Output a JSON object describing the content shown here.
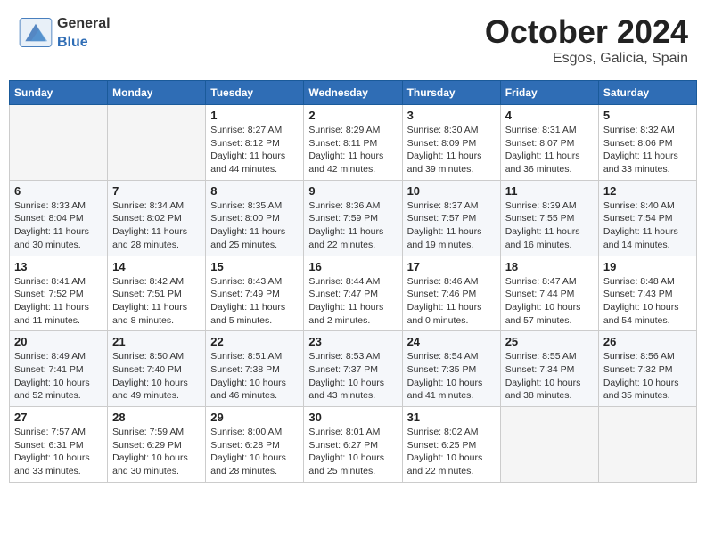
{
  "header": {
    "logo_general": "General",
    "logo_blue": "Blue",
    "title": "October 2024",
    "subtitle": "Esgos, Galicia, Spain"
  },
  "calendar": {
    "days_of_week": [
      "Sunday",
      "Monday",
      "Tuesday",
      "Wednesday",
      "Thursday",
      "Friday",
      "Saturday"
    ],
    "weeks": [
      {
        "row_class": "week-row-1",
        "days": [
          {
            "date": "",
            "info": ""
          },
          {
            "date": "",
            "info": ""
          },
          {
            "date": "1",
            "info": "Sunrise: 8:27 AM\nSunset: 8:12 PM\nDaylight: 11 hours\nand 44 minutes."
          },
          {
            "date": "2",
            "info": "Sunrise: 8:29 AM\nSunset: 8:11 PM\nDaylight: 11 hours\nand 42 minutes."
          },
          {
            "date": "3",
            "info": "Sunrise: 8:30 AM\nSunset: 8:09 PM\nDaylight: 11 hours\nand 39 minutes."
          },
          {
            "date": "4",
            "info": "Sunrise: 8:31 AM\nSunset: 8:07 PM\nDaylight: 11 hours\nand 36 minutes."
          },
          {
            "date": "5",
            "info": "Sunrise: 8:32 AM\nSunset: 8:06 PM\nDaylight: 11 hours\nand 33 minutes."
          }
        ]
      },
      {
        "row_class": "week-row-2",
        "days": [
          {
            "date": "6",
            "info": "Sunrise: 8:33 AM\nSunset: 8:04 PM\nDaylight: 11 hours\nand 30 minutes."
          },
          {
            "date": "7",
            "info": "Sunrise: 8:34 AM\nSunset: 8:02 PM\nDaylight: 11 hours\nand 28 minutes."
          },
          {
            "date": "8",
            "info": "Sunrise: 8:35 AM\nSunset: 8:00 PM\nDaylight: 11 hours\nand 25 minutes."
          },
          {
            "date": "9",
            "info": "Sunrise: 8:36 AM\nSunset: 7:59 PM\nDaylight: 11 hours\nand 22 minutes."
          },
          {
            "date": "10",
            "info": "Sunrise: 8:37 AM\nSunset: 7:57 PM\nDaylight: 11 hours\nand 19 minutes."
          },
          {
            "date": "11",
            "info": "Sunrise: 8:39 AM\nSunset: 7:55 PM\nDaylight: 11 hours\nand 16 minutes."
          },
          {
            "date": "12",
            "info": "Sunrise: 8:40 AM\nSunset: 7:54 PM\nDaylight: 11 hours\nand 14 minutes."
          }
        ]
      },
      {
        "row_class": "week-row-3",
        "days": [
          {
            "date": "13",
            "info": "Sunrise: 8:41 AM\nSunset: 7:52 PM\nDaylight: 11 hours\nand 11 minutes."
          },
          {
            "date": "14",
            "info": "Sunrise: 8:42 AM\nSunset: 7:51 PM\nDaylight: 11 hours\nand 8 minutes."
          },
          {
            "date": "15",
            "info": "Sunrise: 8:43 AM\nSunset: 7:49 PM\nDaylight: 11 hours\nand 5 minutes."
          },
          {
            "date": "16",
            "info": "Sunrise: 8:44 AM\nSunset: 7:47 PM\nDaylight: 11 hours\nand 2 minutes."
          },
          {
            "date": "17",
            "info": "Sunrise: 8:46 AM\nSunset: 7:46 PM\nDaylight: 11 hours\nand 0 minutes."
          },
          {
            "date": "18",
            "info": "Sunrise: 8:47 AM\nSunset: 7:44 PM\nDaylight: 10 hours\nand 57 minutes."
          },
          {
            "date": "19",
            "info": "Sunrise: 8:48 AM\nSunset: 7:43 PM\nDaylight: 10 hours\nand 54 minutes."
          }
        ]
      },
      {
        "row_class": "week-row-4",
        "days": [
          {
            "date": "20",
            "info": "Sunrise: 8:49 AM\nSunset: 7:41 PM\nDaylight: 10 hours\nand 52 minutes."
          },
          {
            "date": "21",
            "info": "Sunrise: 8:50 AM\nSunset: 7:40 PM\nDaylight: 10 hours\nand 49 minutes."
          },
          {
            "date": "22",
            "info": "Sunrise: 8:51 AM\nSunset: 7:38 PM\nDaylight: 10 hours\nand 46 minutes."
          },
          {
            "date": "23",
            "info": "Sunrise: 8:53 AM\nSunset: 7:37 PM\nDaylight: 10 hours\nand 43 minutes."
          },
          {
            "date": "24",
            "info": "Sunrise: 8:54 AM\nSunset: 7:35 PM\nDaylight: 10 hours\nand 41 minutes."
          },
          {
            "date": "25",
            "info": "Sunrise: 8:55 AM\nSunset: 7:34 PM\nDaylight: 10 hours\nand 38 minutes."
          },
          {
            "date": "26",
            "info": "Sunrise: 8:56 AM\nSunset: 7:32 PM\nDaylight: 10 hours\nand 35 minutes."
          }
        ]
      },
      {
        "row_class": "week-row-5",
        "days": [
          {
            "date": "27",
            "info": "Sunrise: 7:57 AM\nSunset: 6:31 PM\nDaylight: 10 hours\nand 33 minutes."
          },
          {
            "date": "28",
            "info": "Sunrise: 7:59 AM\nSunset: 6:29 PM\nDaylight: 10 hours\nand 30 minutes."
          },
          {
            "date": "29",
            "info": "Sunrise: 8:00 AM\nSunset: 6:28 PM\nDaylight: 10 hours\nand 28 minutes."
          },
          {
            "date": "30",
            "info": "Sunrise: 8:01 AM\nSunset: 6:27 PM\nDaylight: 10 hours\nand 25 minutes."
          },
          {
            "date": "31",
            "info": "Sunrise: 8:02 AM\nSunset: 6:25 PM\nDaylight: 10 hours\nand 22 minutes."
          },
          {
            "date": "",
            "info": ""
          },
          {
            "date": "",
            "info": ""
          }
        ]
      }
    ]
  }
}
